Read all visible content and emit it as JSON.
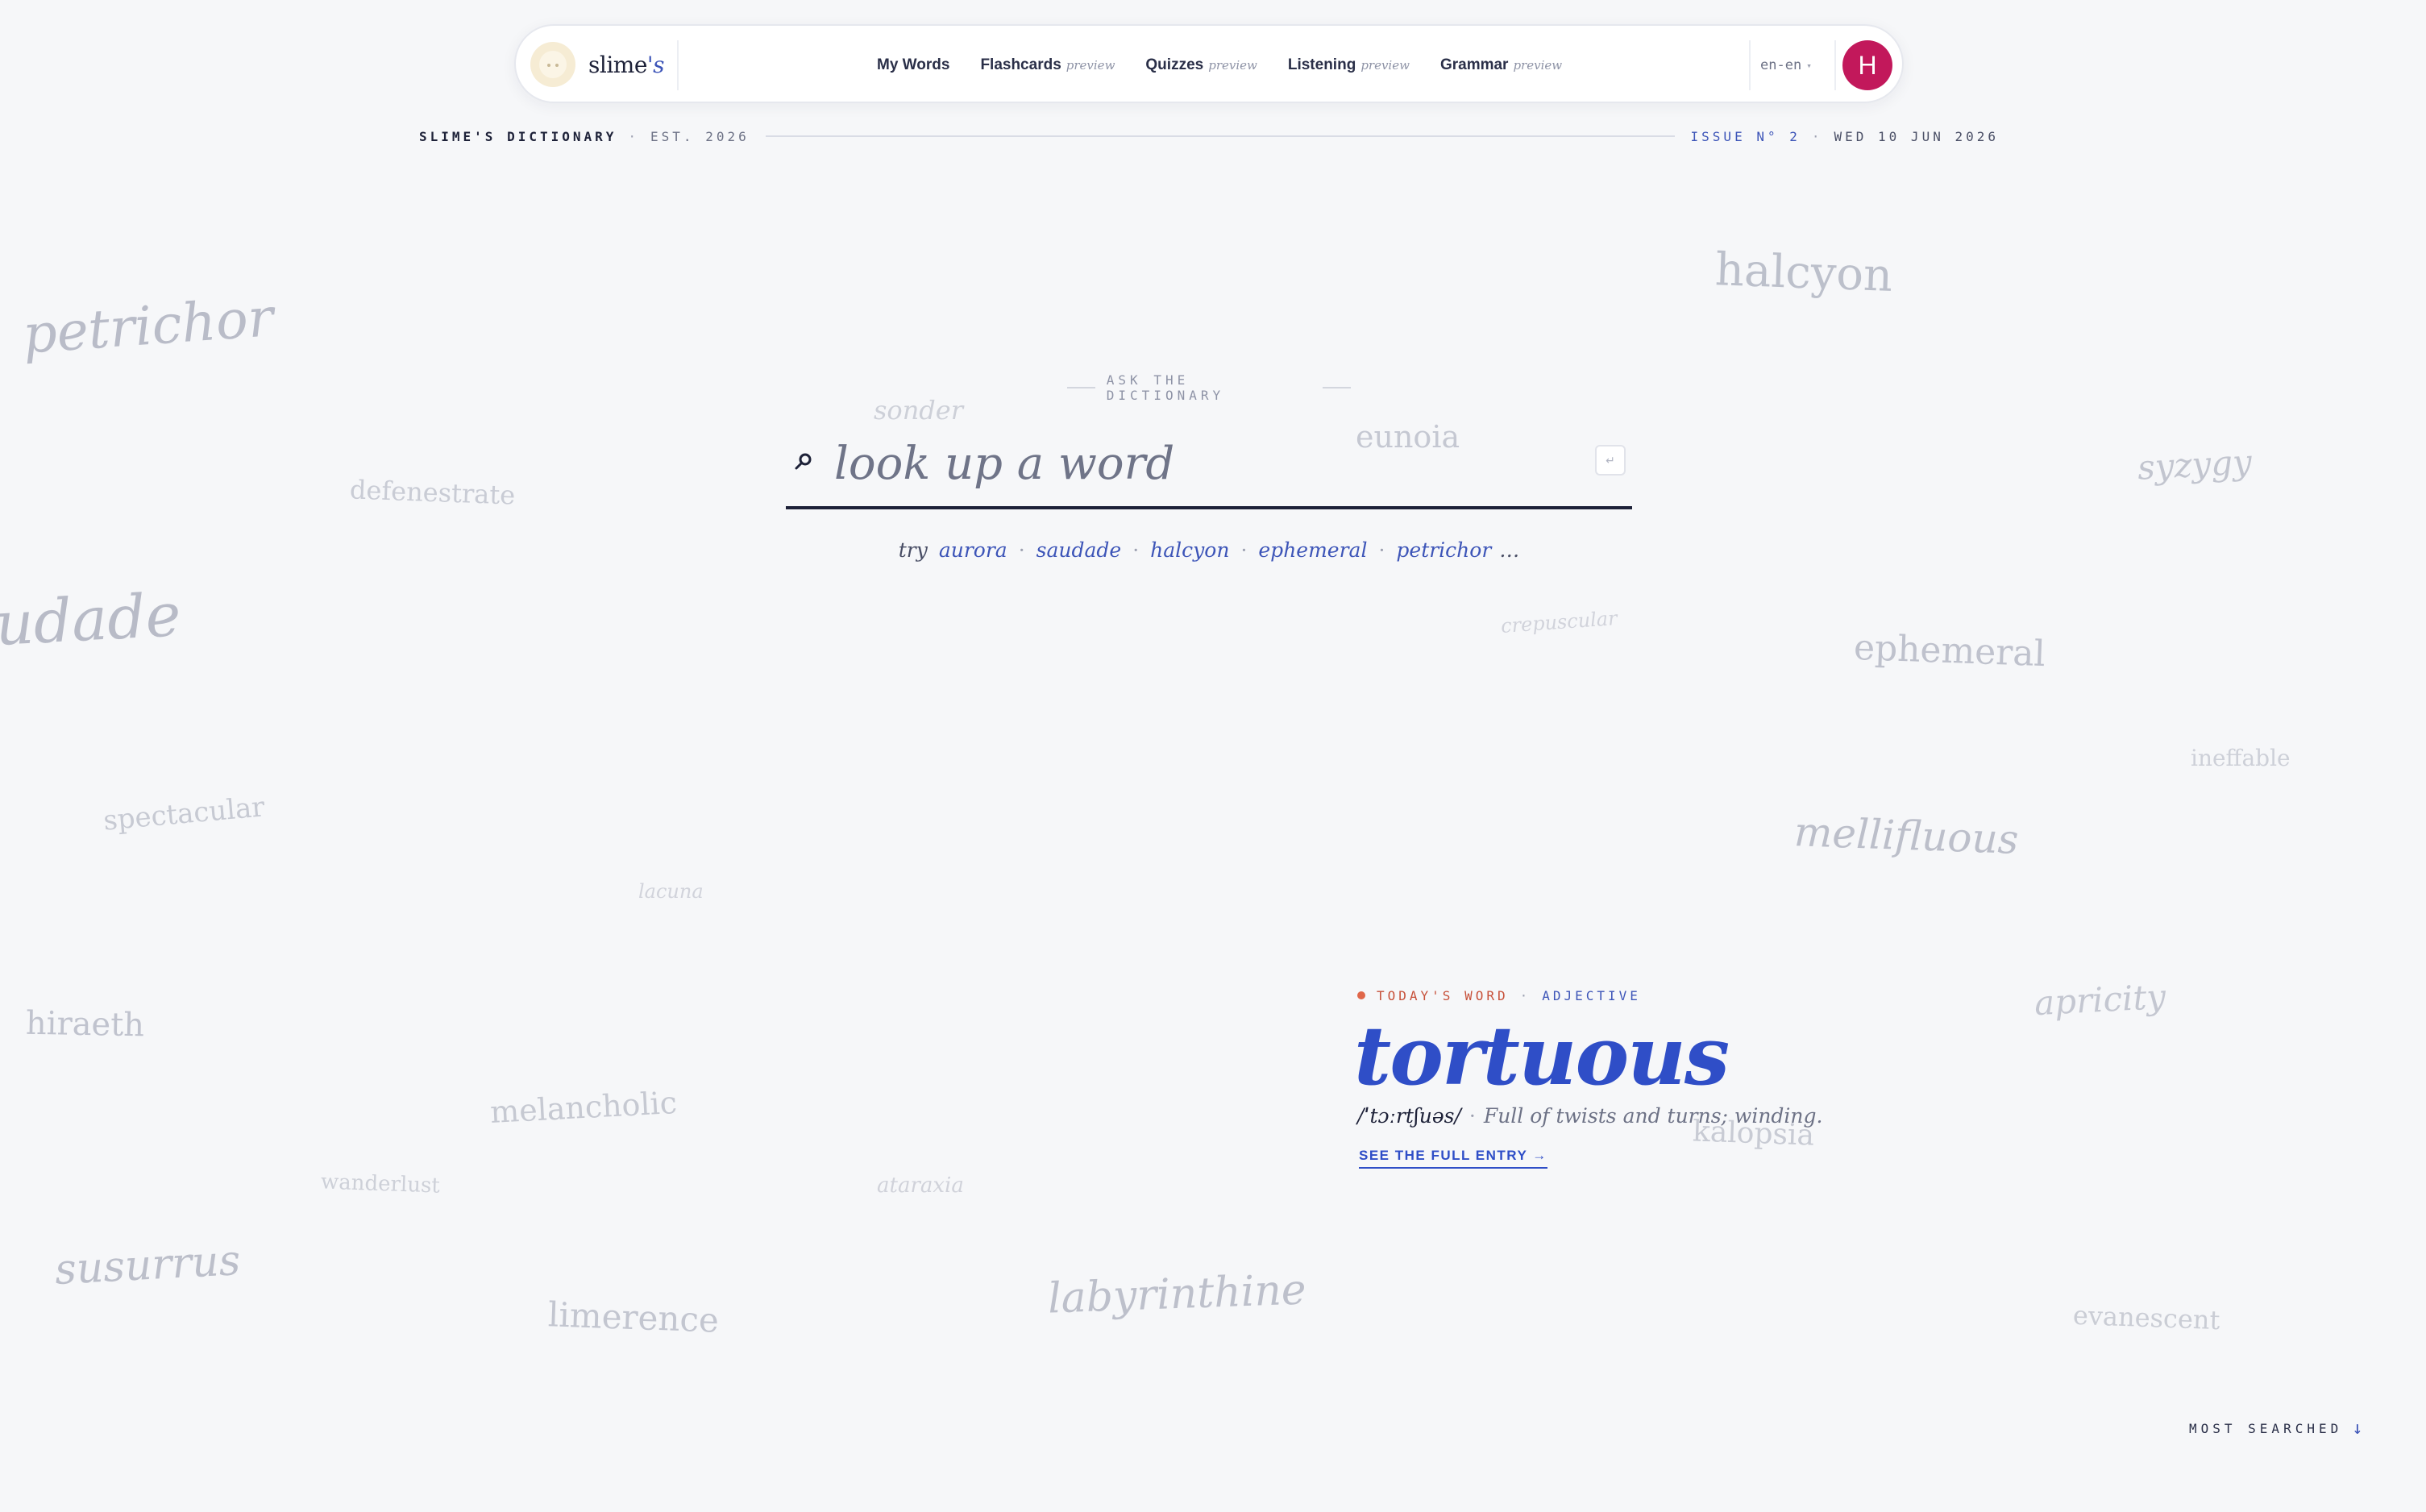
{
  "brand": {
    "name": "slime",
    "suffix": "'s",
    "logo_icon": "slime-face-icon"
  },
  "nav": {
    "items": [
      {
        "label": "My Words",
        "tag": ""
      },
      {
        "label": "Flashcards",
        "tag": "preview"
      },
      {
        "label": "Quizzes",
        "tag": "preview"
      },
      {
        "label": "Listening",
        "tag": "preview"
      },
      {
        "label": "Grammar",
        "tag": "preview"
      }
    ],
    "language": "en-en",
    "avatar_initial": "H"
  },
  "masthead": {
    "title": "SLIME'S DICTIONARY",
    "est": "EST. 2026",
    "issue": "ISSUE N° 2",
    "date": "WED 10 JUN 2026"
  },
  "floating_words": [
    "petrichor",
    "halcyon",
    "sonder",
    "eunoia",
    "syzygy",
    "defenestrate",
    "udade",
    "crepuscular",
    "ephemeral",
    "ineffable",
    "spectacular",
    "mellifluous",
    "lacuna",
    "apricity",
    "hiraeth",
    "melancholic",
    "kalopsia",
    "wanderlust",
    "ataraxia",
    "susurrus",
    "labyrinthine",
    "limerence",
    "evanescent"
  ],
  "search": {
    "eyebrow": "ASK THE DICTIONARY",
    "placeholder": "look up a word",
    "enter_key": "↵",
    "try_label": "try",
    "suggestions": [
      "aurora",
      "saudade",
      "halcyon",
      "ephemeral",
      "petrichor"
    ],
    "more": "…"
  },
  "wotd": {
    "label": "TODAY'S WORD",
    "part_of_speech": "ADJECTIVE",
    "word": "tortuous",
    "pronunciation": "/ˈtɔːrtʃuəs/",
    "definition": "Full of twists and turns; winding.",
    "link": "SEE THE FULL ENTRY →"
  },
  "most_searched": {
    "label": "MOST SEARCHED",
    "arrow": "↓"
  },
  "colors": {
    "accent": "#2f4ec7",
    "avatar": "#c2185b",
    "wotd_dot": "#e0674a",
    "background": "#f6f7f9"
  }
}
